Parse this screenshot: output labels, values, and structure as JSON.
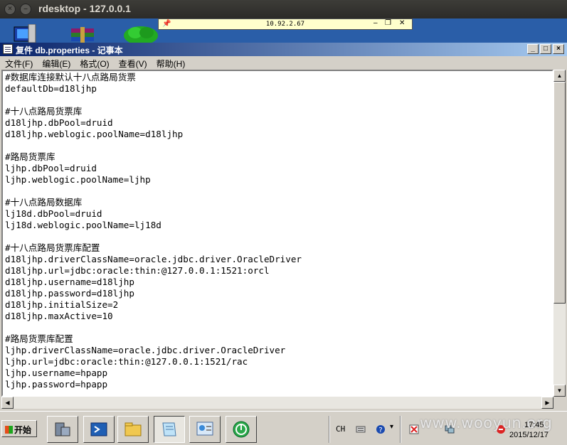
{
  "outer_window": {
    "title": "rdesktop - 127.0.0.1"
  },
  "remote_bar": {
    "host": "10.92.2.67"
  },
  "notepad": {
    "title": "复件 db.properties - 记事本",
    "menu": [
      "文件(F)",
      "编辑(E)",
      "格式(O)",
      "查看(V)",
      "帮助(H)"
    ],
    "content_lines": [
      "#数据库连接默认十八点路局货票",
      "defaultDb=d18ljhp",
      "",
      "#十八点路局货票库",
      "d18ljhp.dbPool=druid",
      "d18ljhp.weblogic.poolName=d18ljhp",
      "",
      "#路局货票库",
      "ljhp.dbPool=druid",
      "ljhp.weblogic.poolName=ljhp",
      "",
      "#十八点路局数据库",
      "lj18d.dbPool=druid",
      "lj18d.weblogic.poolName=lj18d",
      "",
      "#十八点路局货票库配置",
      "d18ljhp.driverClassName=oracle.jdbc.driver.OracleDriver",
      "d18ljhp.url=jdbc:oracle:thin:@127.0.0.1:1521:orcl",
      "d18ljhp.username=d18ljhp",
      "d18ljhp.password=d18ljhp",
      "d18ljhp.initialSize=2",
      "d18ljhp.maxActive=10",
      "",
      "#路局货票库配置",
      "ljhp.driverClassName=oracle.jdbc.driver.OracleDriver",
      "ljhp.url=jdbc:oracle:thin:@127.0.0.1:1521/rac",
      "ljhp.username=hpapp",
      "ljhp.password=hpapp"
    ]
  },
  "taskbar": {
    "start_label": "开始",
    "lang": "CH",
    "time": "17:45",
    "date": "2015/12/17",
    "watermark": "www.wooyun.org"
  }
}
